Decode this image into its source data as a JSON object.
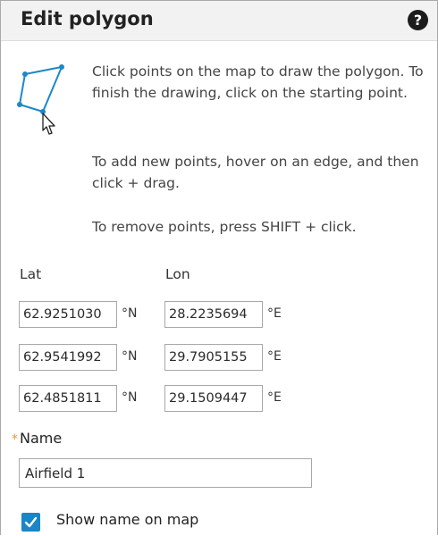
{
  "header": {
    "title": "Edit polygon",
    "help_glyph": "?"
  },
  "icons": {
    "polygon": "polygon-draw-icon",
    "help": "help-icon",
    "check": "checkmark-icon"
  },
  "instructions": {
    "draw": "Click points on the map to draw the polygon. To finish the drawing, click on the starting point.",
    "add": "To add new points, hover on an edge, and then click + drag.",
    "remove": "To remove points, press SHIFT + click."
  },
  "coordinates": {
    "lat_label": "Lat",
    "lon_label": "Lon",
    "lat_unit": "°N",
    "lon_unit": "°E",
    "rows": [
      {
        "lat": "62.9251030",
        "lon": "28.2235694"
      },
      {
        "lat": "62.9541992",
        "lon": "29.7905155"
      },
      {
        "lat": "62.4851811",
        "lon": "29.1509447"
      }
    ]
  },
  "name_field": {
    "required_marker": "*",
    "label": "Name",
    "value": "Airfield 1"
  },
  "show_name": {
    "label": "Show name on map",
    "checked": true
  },
  "colors": {
    "accent": "#1a85c7",
    "icon_stroke": "#1b88c9",
    "required": "#e69a3c"
  }
}
